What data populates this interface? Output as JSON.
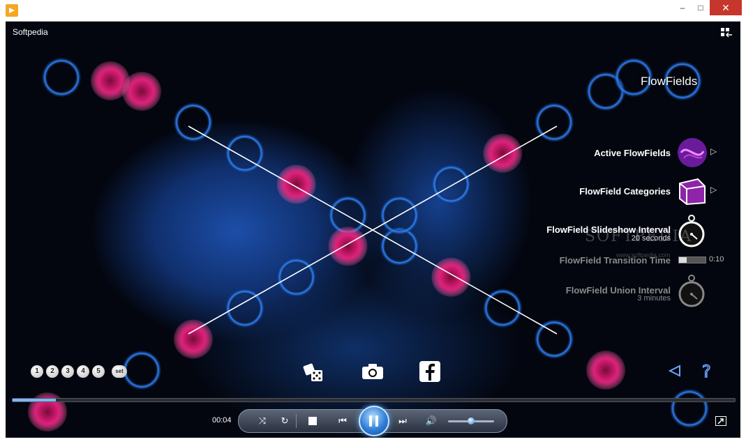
{
  "window": {
    "minimize_label": "–",
    "maximize_label": "□",
    "close_label": "✕"
  },
  "player": {
    "title": "Softpedia"
  },
  "visualizer_menu": {
    "title": "FlowFields",
    "items": [
      {
        "label": "Active FlowFields"
      },
      {
        "label": "FlowField Categories"
      },
      {
        "label": "FlowField Slideshow Interval",
        "sub": "20 seconds"
      },
      {
        "label": "FlowField Transition Time",
        "value": "0:10",
        "progress": 0.3
      },
      {
        "label": "FlowField Union Interval",
        "sub": "3 minutes"
      }
    ]
  },
  "presets": {
    "buttons": [
      "1",
      "2",
      "3",
      "4",
      "5"
    ],
    "set_label": "set"
  },
  "watermark": {
    "text": "SOFTPEDIA",
    "sub": "www.softpedia.com"
  },
  "transport": {
    "elapsed": "00:04",
    "seek_progress": 0.06,
    "volume_level": 0.5
  },
  "colors": {
    "accent": "#2d7fd8",
    "flow_pink": "#e0207a",
    "flow_blue": "#1e6fe0"
  }
}
